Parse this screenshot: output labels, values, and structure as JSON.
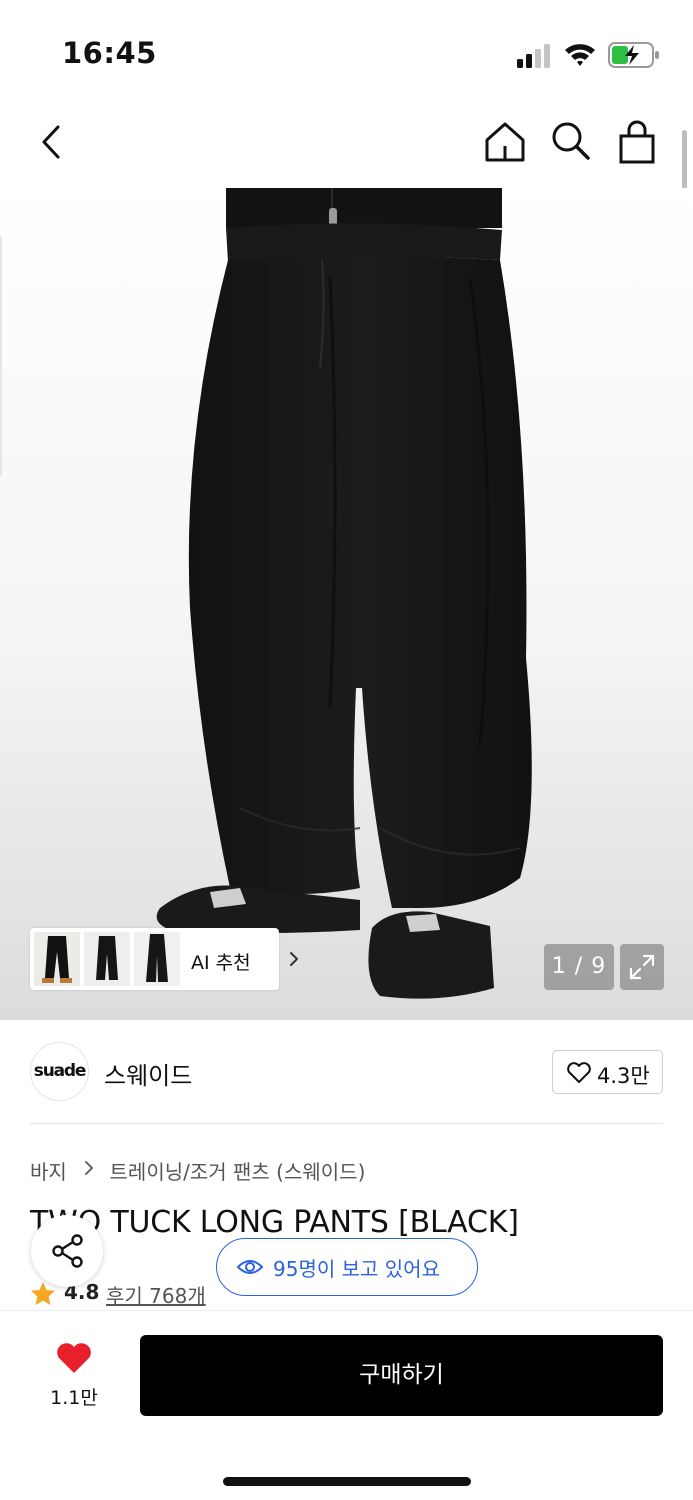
{
  "status_bar": {
    "time": "16:45",
    "icons": [
      "signal-icon",
      "wifi-icon",
      "battery-charging-icon"
    ],
    "battery_color": "#2fbf45"
  },
  "nav": {
    "icons": [
      "back-icon",
      "home-icon",
      "search-icon",
      "shopping-bag-icon"
    ]
  },
  "gallery": {
    "counter": "1 / 9",
    "ai_recommend_label": "AI 추천",
    "expand_icon": "expand-icon"
  },
  "brand": {
    "logo_text": "suade",
    "name": "스웨이드",
    "likes": "4.3만"
  },
  "product": {
    "breadcrumb": [
      "바지",
      "트레이닝/조거 팬츠 (스웨이드)"
    ],
    "title": "TWO TUCK LONG PANTS [BLACK]",
    "rating": "4.8",
    "reviews_label": "후기 768개",
    "viewers_text": "95명이 보고 있어요"
  },
  "bottom_bar": {
    "wish_count": "1.1만",
    "buy_label": "구매하기"
  },
  "colors": {
    "accent_blue": "#2b63e0",
    "heart_red": "#e8202c",
    "star_orange": "#f5a623",
    "buy_button": "#000000"
  }
}
